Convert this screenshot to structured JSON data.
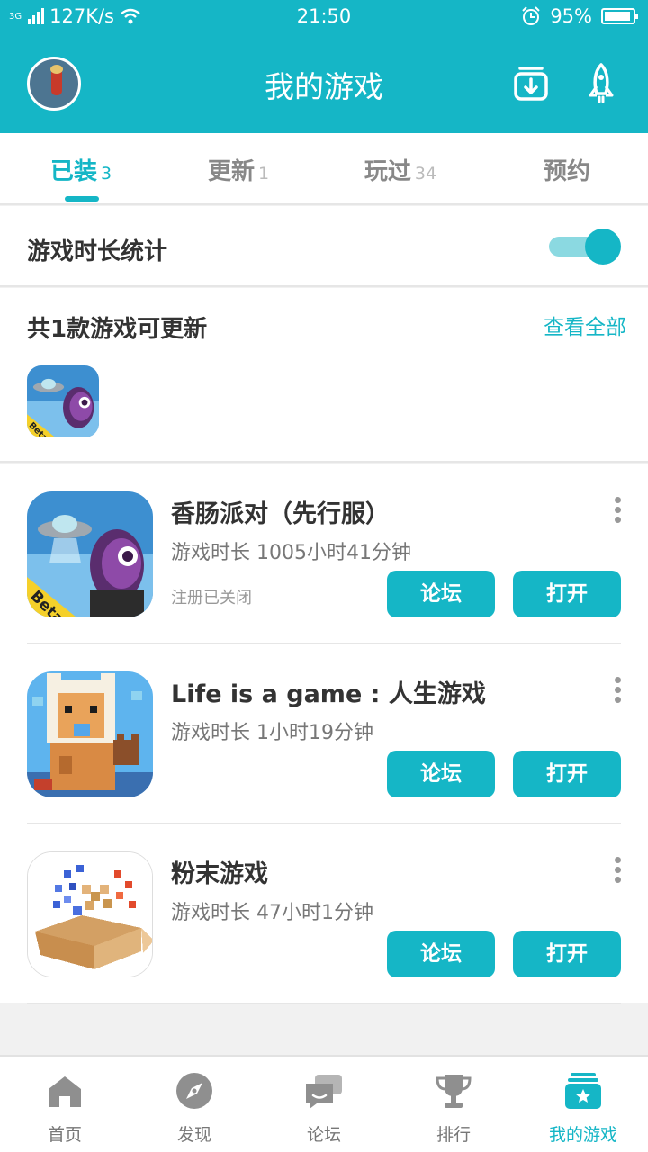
{
  "status_bar": {
    "network_type": "3G",
    "speed": "127K/s",
    "time": "21:50",
    "battery": "95%"
  },
  "header": {
    "title": "我的游戏",
    "download_icon": "download-box-icon",
    "boost_icon": "rocket-icon"
  },
  "tabs": [
    {
      "label": "已装",
      "count": "3",
      "active": true
    },
    {
      "label": "更新",
      "count": "1",
      "active": false
    },
    {
      "label": "玩过",
      "count": "34",
      "active": false
    },
    {
      "label": "预约",
      "count": "",
      "active": false
    }
  ],
  "playtime_stats": {
    "label": "游戏时长统计",
    "enabled": true
  },
  "updates": {
    "title": "共1款游戏可更新",
    "see_all": "查看全部",
    "badge": "Beta"
  },
  "games": [
    {
      "name": "香肠派对（先行服）",
      "playtime": "游戏时长 1005小时41分钟",
      "note": "注册已关闭",
      "badge": "Beta",
      "forum_label": "论坛",
      "open_label": "打开"
    },
    {
      "name": "Life is a game : 人生游戏",
      "playtime": "游戏时长 1小时19分钟",
      "note": "",
      "forum_label": "论坛",
      "open_label": "打开"
    },
    {
      "name": "粉末游戏",
      "playtime": "游戏时长 47小时1分钟",
      "note": "",
      "forum_label": "论坛",
      "open_label": "打开"
    }
  ],
  "bottom_nav": [
    {
      "label": "首页",
      "icon": "home-icon",
      "active": false
    },
    {
      "label": "发现",
      "icon": "compass-icon",
      "active": false
    },
    {
      "label": "论坛",
      "icon": "chat-bubbles-icon",
      "active": false
    },
    {
      "label": "排行",
      "icon": "trophy-icon",
      "active": false
    },
    {
      "label": "我的游戏",
      "icon": "game-stack-star-icon",
      "active": true
    }
  ],
  "colors": {
    "accent": "#15b6c6",
    "accent_light": "#8bd9e1",
    "inactive_icon": "#8f8f8f"
  }
}
